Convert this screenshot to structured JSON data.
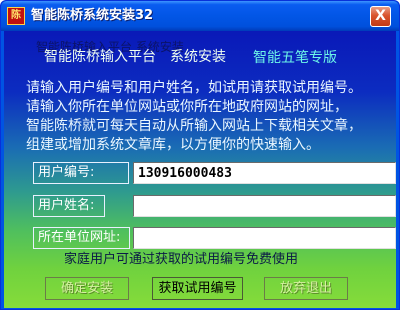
{
  "window": {
    "title": "智能陈桥系统安装32",
    "icon_name": "app-logo-icon",
    "close_glyph": "X"
  },
  "header": {
    "ghost_text": "智能陈桥输入平台 系统安装",
    "main_text": "智能陈桥输入平台　系统安装",
    "right_text": "智能五笔专版"
  },
  "instructions": [
    "请输入用户编号和用户姓名，如试用请获取试用编号。",
    "请输入你所在单位网站或你所在地政府网站的网址，",
    "智能陈桥就可每天自动从所输入网站上下载相关文章，",
    "组建或增加系统文章库，以方便你的快速输入。"
  ],
  "form": {
    "user_id_label": "用户编号:",
    "user_id_value": "130916000483",
    "user_name_label": "用户姓名:",
    "user_name_value": "",
    "org_url_label": "所在单位网址:",
    "org_url_value": ""
  },
  "notice": "家庭用户可通过获取的试用编号免费使用",
  "buttons": {
    "confirm_label": "确定安装",
    "trial_label": "获取试用编号",
    "exit_label": "放弃退出"
  },
  "colors": {
    "title_bar": "#0256e6",
    "gradient_top": "#0a19b8",
    "gradient_bottom": "#86dc3a",
    "heading_right": "#6cf5e8"
  }
}
